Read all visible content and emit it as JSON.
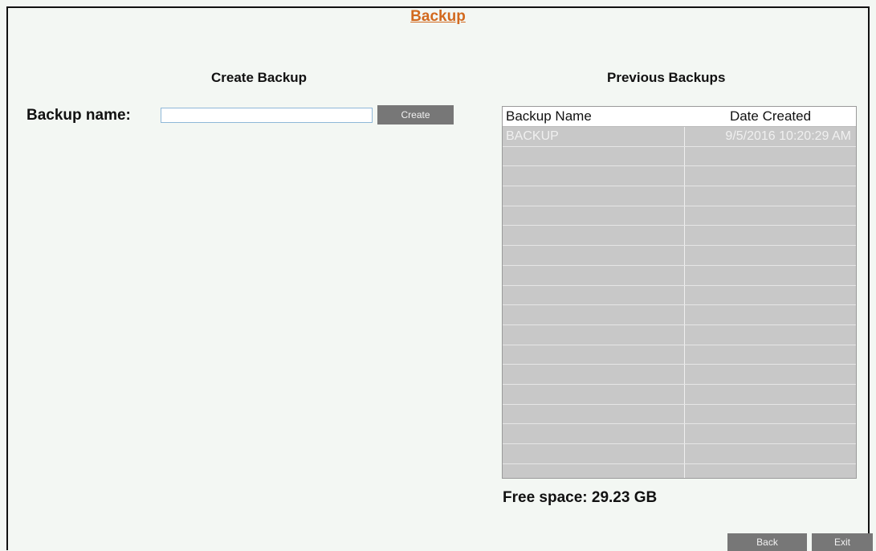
{
  "page": {
    "title": "Backup"
  },
  "create": {
    "heading": "Create Backup",
    "name_label": "Backup name:",
    "name_value": "",
    "create_label": "Create"
  },
  "previous": {
    "heading": "Previous Backups",
    "columns": [
      "Backup Name",
      "Date Created"
    ],
    "rows": [
      {
        "name": "BACKUP",
        "date": "9/5/2016 10:20:29 AM"
      },
      {
        "name": "",
        "date": ""
      },
      {
        "name": "",
        "date": ""
      },
      {
        "name": "",
        "date": ""
      },
      {
        "name": "",
        "date": ""
      },
      {
        "name": "",
        "date": ""
      },
      {
        "name": "",
        "date": ""
      },
      {
        "name": "",
        "date": ""
      },
      {
        "name": "",
        "date": ""
      },
      {
        "name": "",
        "date": ""
      },
      {
        "name": "",
        "date": ""
      },
      {
        "name": "",
        "date": ""
      },
      {
        "name": "",
        "date": ""
      },
      {
        "name": "",
        "date": ""
      },
      {
        "name": "",
        "date": ""
      },
      {
        "name": "",
        "date": ""
      },
      {
        "name": "",
        "date": ""
      },
      {
        "name": "",
        "date": ""
      }
    ],
    "free_space": "Free space: 29.23 GB"
  },
  "footer": {
    "back_label": "Back",
    "exit_label": "Exit"
  },
  "colors": {
    "title": "#d2691e",
    "button": "#777777",
    "table_bg": "#c8c8c8"
  }
}
